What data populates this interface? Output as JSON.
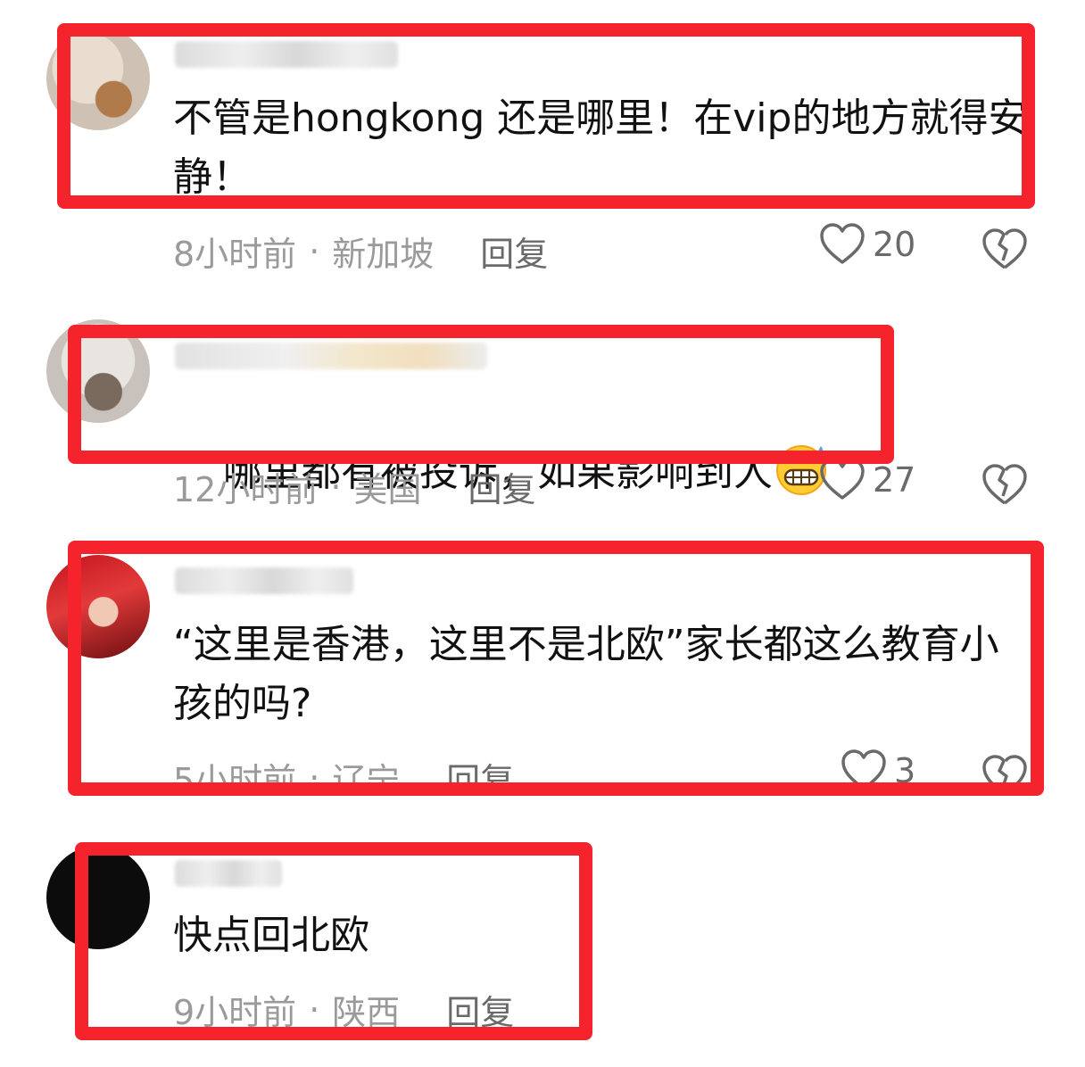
{
  "accent_color": "#f5232b",
  "comments": [
    {
      "avatar": "dog-avatar",
      "text": "不管是hongkong 还是哪里！在vip的地方就得安静！",
      "time": "8小时前",
      "location": "新加坡",
      "reply": "回复",
      "likes": "20"
    },
    {
      "avatar": "hands-avatar",
      "text": "哪里都有被投诉，如果影响到人",
      "emoji": "grinning-sweat-emoji",
      "time": "12小时前",
      "location": "美国",
      "reply": "回复",
      "likes": "27"
    },
    {
      "avatar": "red-dress-avatar",
      "text": "“这里是香港，这里不是北欧”家长都这么教育小孩的吗?",
      "time": "5小时前",
      "location": "辽宁",
      "reply": "回复",
      "likes": "3"
    },
    {
      "avatar": "black-avatar",
      "text": "快点回北欧",
      "time": "9小时前",
      "location": "陕西",
      "reply": "回复"
    }
  ],
  "separator": "·"
}
